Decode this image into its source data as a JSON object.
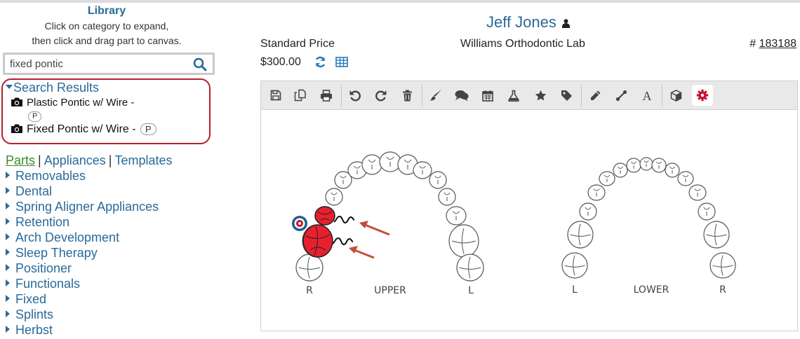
{
  "library": {
    "title": "Library",
    "help_line1": "Click on category to expand,",
    "help_line2": "then click and drag part to canvas.",
    "search_value": "fixed pontic",
    "search_results": {
      "heading": "Search Results",
      "items": [
        {
          "label": "Plastic Pontic w/ Wire -",
          "badge": "P"
        },
        {
          "label": "Fixed Pontic w/ Wire -",
          "badge": "P"
        }
      ]
    },
    "tabs": {
      "parts": "Parts",
      "appliances": "Appliances",
      "templates": "Templates",
      "separator": "|"
    },
    "categories": [
      "Removables",
      "Dental",
      "Spring Aligner Appliances",
      "Retention",
      "Arch Development",
      "Sleep Therapy",
      "Positioner",
      "Functionals",
      "Fixed",
      "Splints",
      "Herbst"
    ]
  },
  "header": {
    "patient_name": "Jeff Jones",
    "price_label": "Standard Price",
    "price_value": "$300.00",
    "lab_name": "Williams Orthodontic Lab",
    "case_prefix": "#",
    "case_number": "183188"
  },
  "toolbar": {
    "buttons": [
      "save-icon",
      "copy-icon",
      "print-icon",
      "undo-icon",
      "redo-icon",
      "trash-icon",
      "brush-icon",
      "comments-icon",
      "calendar-icon",
      "flask-icon",
      "star-icon",
      "tag-icon",
      "pencil-icon",
      "connector-icon",
      "text-icon",
      "cube-icon",
      "gear-icon"
    ],
    "active": "gear-icon"
  },
  "canvas": {
    "upper": {
      "label": "UPPER",
      "left": "R",
      "right": "L"
    },
    "lower": {
      "label": "LOWER",
      "left": "L",
      "right": "R"
    }
  },
  "colors": {
    "link": "#2a6a9a",
    "accent_red": "#b3202e",
    "part_fill": "#e8202e",
    "arrow": "#c0503a",
    "active_tab": "#3b8a2a"
  }
}
